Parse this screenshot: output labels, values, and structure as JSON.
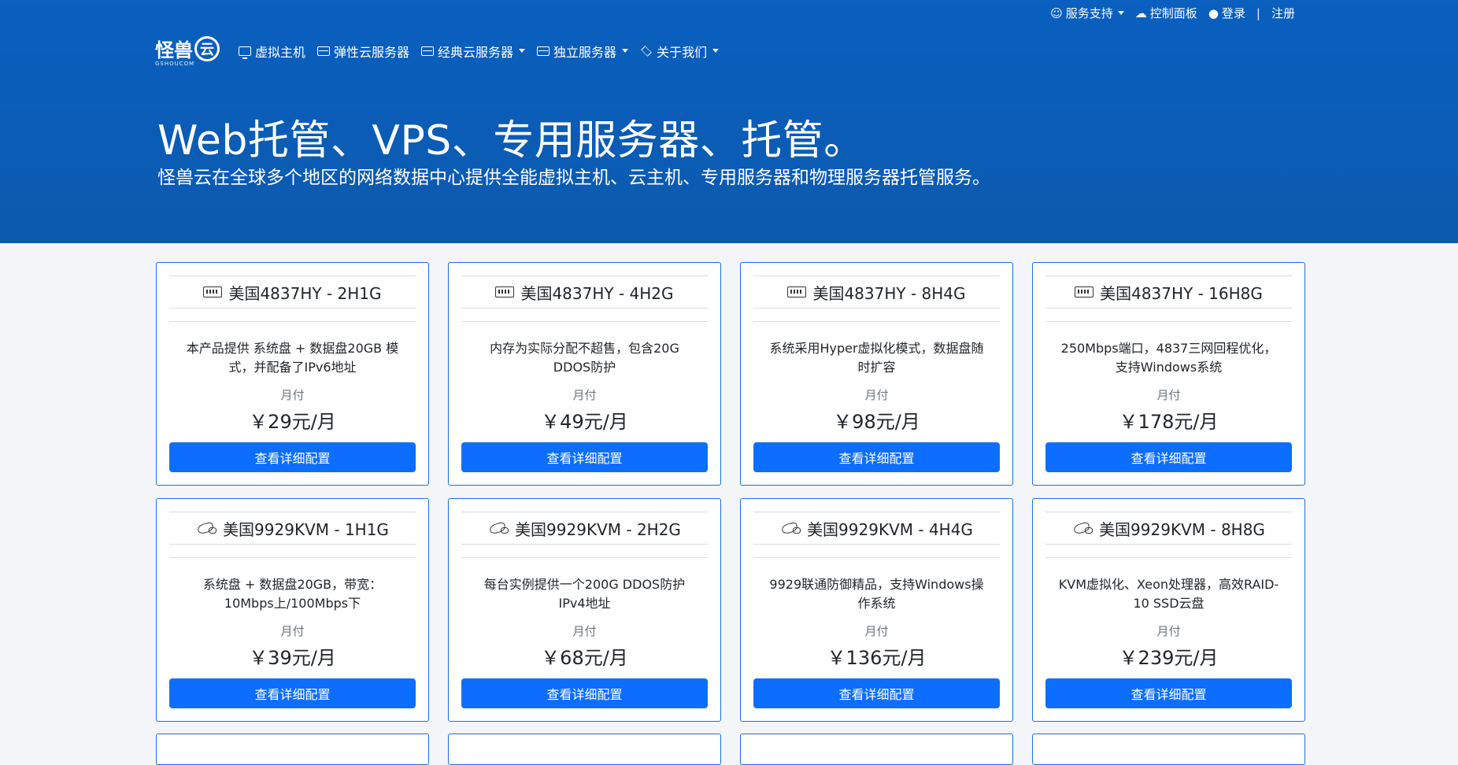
{
  "topbar": {
    "support": "服务支持",
    "control_panel": "控制面板",
    "login": "登录",
    "separator": "|",
    "register": "注册"
  },
  "logo": {
    "text": "怪兽",
    "cloud": "云",
    "subtext": "GSHOUCOM"
  },
  "nav": [
    {
      "label": "虚拟主机",
      "icon": "monitor-icon",
      "dropdown": false
    },
    {
      "label": "弹性云服务器",
      "icon": "server-icon",
      "dropdown": false
    },
    {
      "label": "经典云服务器",
      "icon": "server-icon",
      "dropdown": true
    },
    {
      "label": "独立服务器",
      "icon": "server-icon",
      "dropdown": true
    },
    {
      "label": "关于我们",
      "icon": "layers-icon",
      "dropdown": true
    }
  ],
  "hero": {
    "title": "Web托管、VPS、专用服务器、托管。",
    "subtitle": "怪兽云在全球多个地区的网络数据中心提供全能虚拟主机、云主机、专用服务器和物理服务器托管服务。"
  },
  "colors": {
    "hero_bg": "#0a5fbf",
    "accent": "#0d6efd",
    "card_border": "#1e6fd9"
  },
  "products": [
    {
      "icon": "memory-icon",
      "title": "美国4837HY - 2H1G",
      "desc": "本产品提供 系统盘 + 数据盘20GB 模式，并配备了IPv6地址",
      "period": "月付",
      "price": "￥29元/月",
      "button": "查看详细配置"
    },
    {
      "icon": "memory-icon",
      "title": "美国4837HY - 4H2G",
      "desc": "内存为实际分配不超售，包含20G DDOS防护",
      "period": "月付",
      "price": "￥49元/月",
      "button": "查看详细配置"
    },
    {
      "icon": "memory-icon",
      "title": "美国4837HY - 8H4G",
      "desc": "系统采用Hyper虚拟化模式，数据盘随时扩容",
      "period": "月付",
      "price": "￥98元/月",
      "button": "查看详细配置"
    },
    {
      "icon": "memory-icon",
      "title": "美国4837HY - 16H8G",
      "desc": "250Mbps端口，4837三网回程优化，支持Windows系统",
      "period": "月付",
      "price": "￥178元/月",
      "button": "查看详细配置"
    },
    {
      "icon": "dragon-icon",
      "title": "美国9929KVM - 1H1G",
      "desc": "系统盘 + 数据盘20GB，带宽：10Mbps上/100Mbps下",
      "period": "月付",
      "price": "￥39元/月",
      "button": "查看详细配置"
    },
    {
      "icon": "dragon-icon",
      "title": "美国9929KVM - 2H2G",
      "desc": "每台实例提供一个200G DDOS防护IPv4地址",
      "period": "月付",
      "price": "￥68元/月",
      "button": "查看详细配置"
    },
    {
      "icon": "dragon-icon",
      "title": "美国9929KVM - 4H4G",
      "desc": "9929联通防御精品，支持Windows操作系统",
      "period": "月付",
      "price": "￥136元/月",
      "button": "查看详细配置"
    },
    {
      "icon": "dragon-icon",
      "title": "美国9929KVM - 8H8G",
      "desc": "KVM虚拟化、Xeon处理器，高效RAID-10 SSD云盘",
      "period": "月付",
      "price": "￥239元/月",
      "button": "查看详细配置"
    }
  ]
}
